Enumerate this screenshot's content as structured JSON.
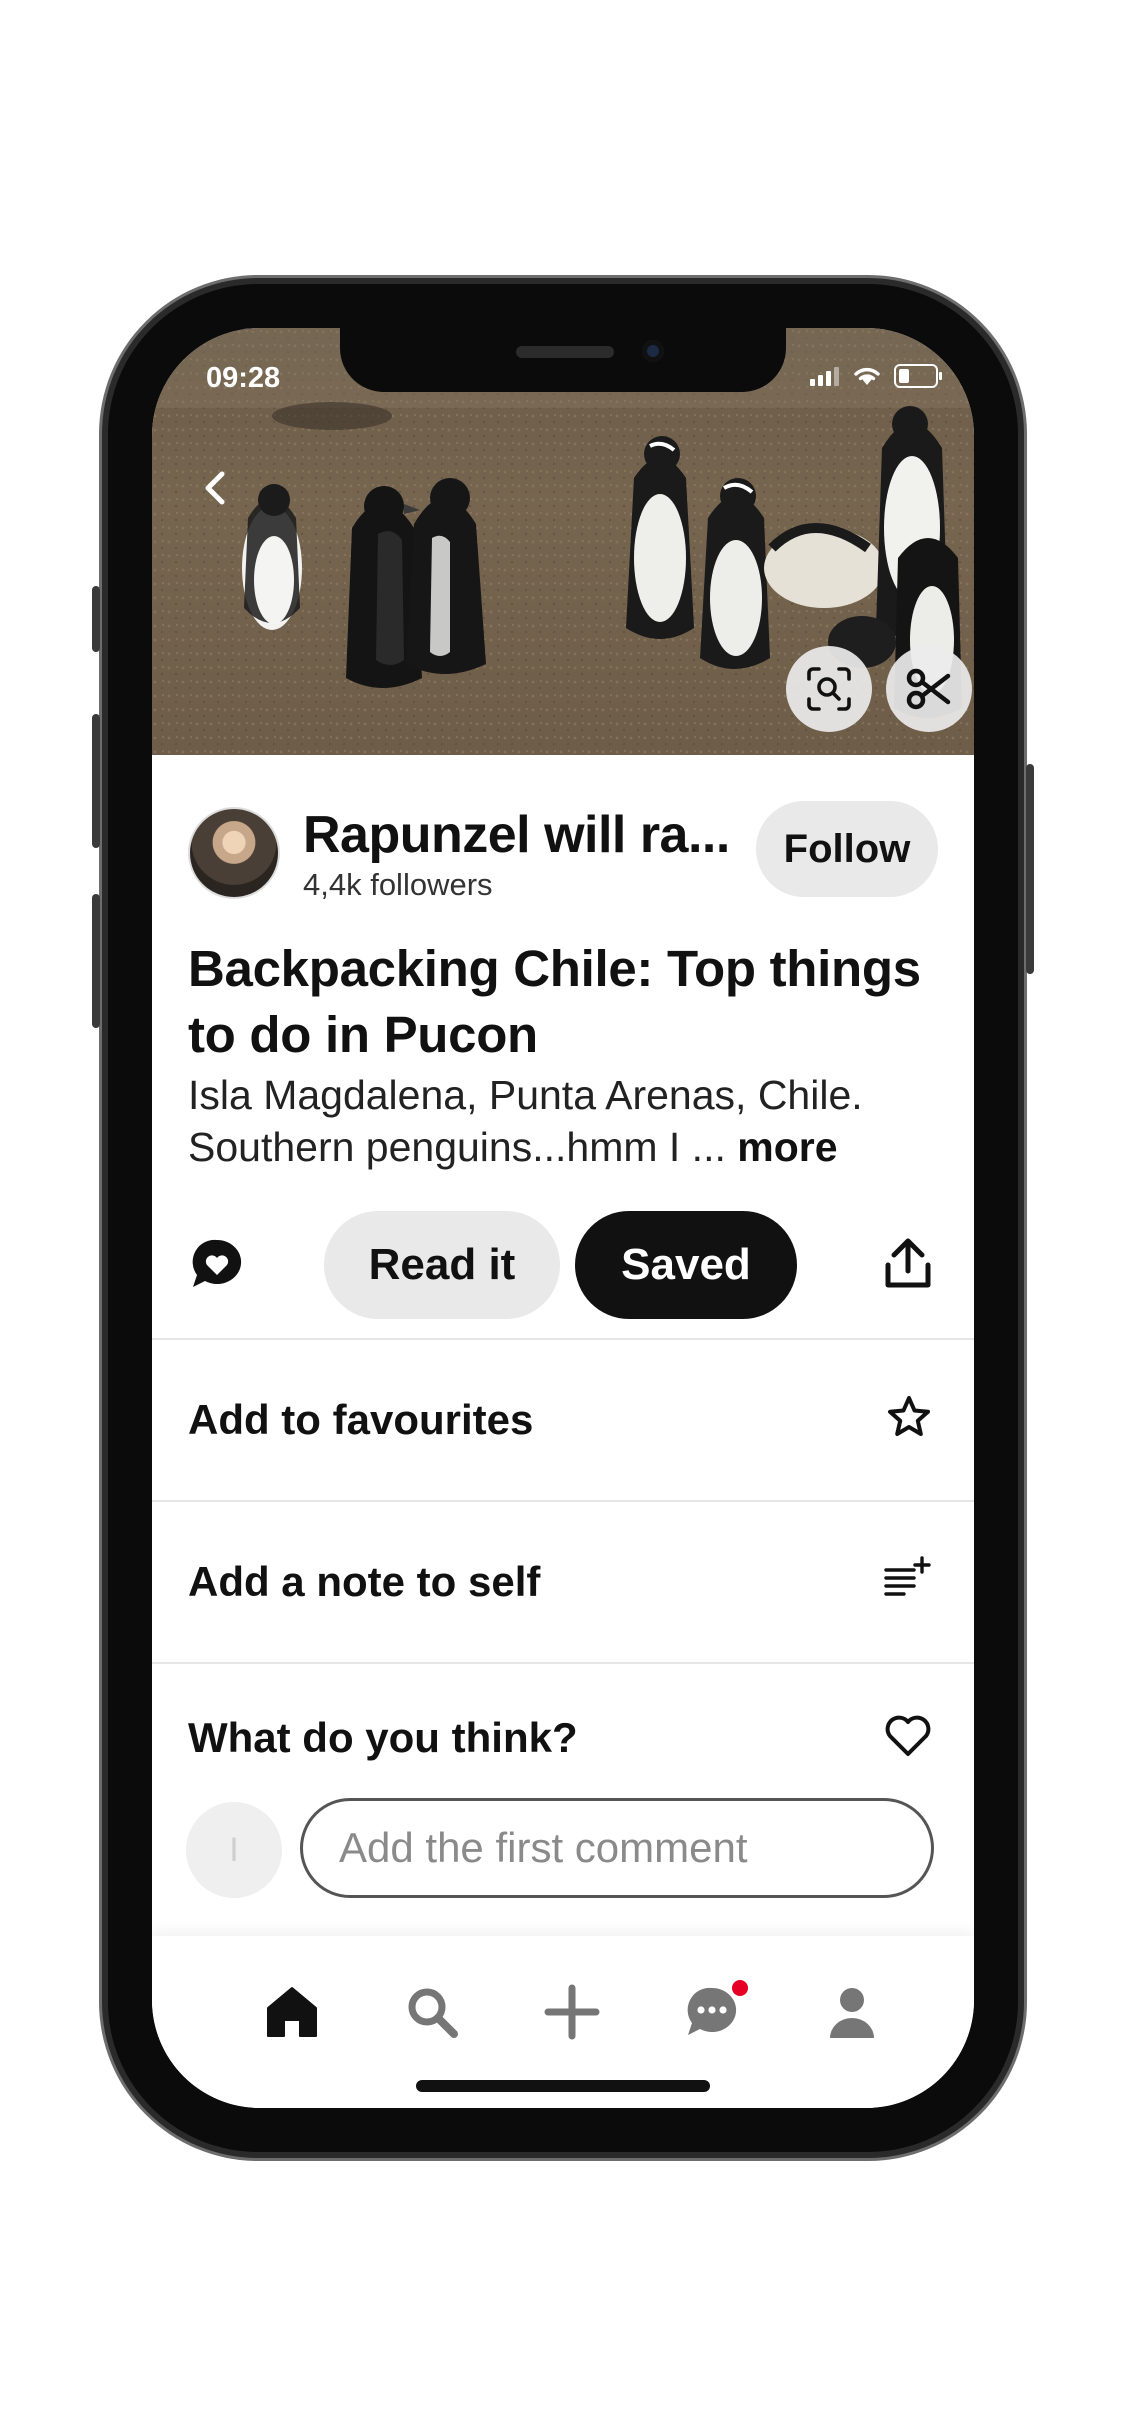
{
  "status": {
    "time": "09:28"
  },
  "creator": {
    "name": "Rapunzel will ra...",
    "followers": "4,4k followers",
    "follow_label": "Follow"
  },
  "pin": {
    "title": "Backpacking Chile: Top things to do in Pucon",
    "description": "Isla Magdalena, Punta Arenas, Chile. Southern penguins...hmm I ...",
    "more_label": "more"
  },
  "actions": {
    "read_label": "Read it",
    "saved_label": "Saved"
  },
  "options": [
    {
      "label": "Add to favourites",
      "icon": "star-icon"
    },
    {
      "label": "Add a note to self",
      "icon": "note-add-icon"
    }
  ],
  "comments": {
    "prompt": "What do you think?",
    "placeholder": "Add the first comment",
    "avatar_initial": "I"
  },
  "tabs": [
    "home-icon",
    "search-icon",
    "create-icon",
    "messages-icon",
    "profile-icon"
  ],
  "colors": {
    "accent": "#e60023",
    "saved_bg": "#111111",
    "pill_bg": "#e9e9e9"
  }
}
